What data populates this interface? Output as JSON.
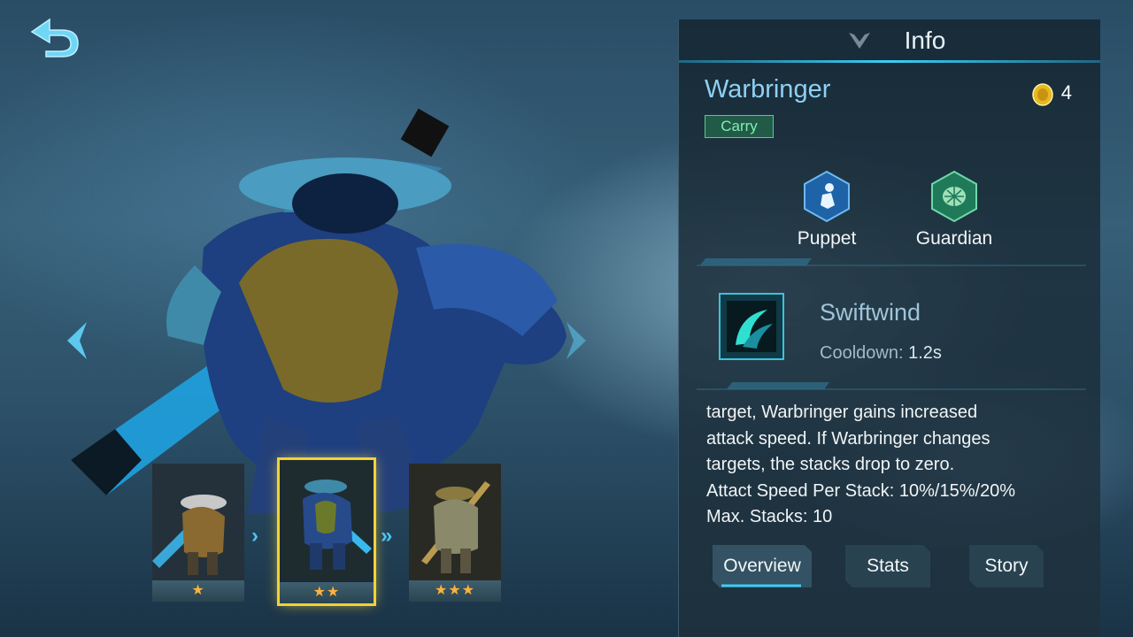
{
  "header": {
    "title": "Info"
  },
  "hero": {
    "name": "Warbringer",
    "cost": "4",
    "role": "Carry"
  },
  "synergies": [
    {
      "label": "Puppet",
      "icon": "puppet-icon",
      "color": "#1e63a8"
    },
    {
      "label": "Guardian",
      "icon": "guardian-shell-icon",
      "color": "#1f7a5a"
    }
  ],
  "skill": {
    "name": "Swiftwind",
    "cooldown_label": "Cooldown:",
    "cooldown_value": "1.2s"
  },
  "description": [
    "target, Warbringer gains increased",
    "attack speed. If Warbringer changes",
    "targets, the stacks drop to zero.",
    "Attact Speed Per Stack: 10%/15%/20%",
    "Max. Stacks: 10"
  ],
  "skins": [
    {
      "stars": "★",
      "selected": false
    },
    {
      "stars": "★★",
      "selected": true
    },
    {
      "stars": "★★★",
      "selected": false
    }
  ],
  "tabs": [
    {
      "label": "Overview",
      "active": true
    },
    {
      "label": "Stats",
      "active": false
    },
    {
      "label": "Story",
      "active": false
    }
  ],
  "colors": {
    "accent": "#3ccdf5",
    "hero_name": "#8fd0f3",
    "role_badge": "#4fd08a",
    "selected_skin": "#f0d23a",
    "star": "#ffb23a"
  }
}
